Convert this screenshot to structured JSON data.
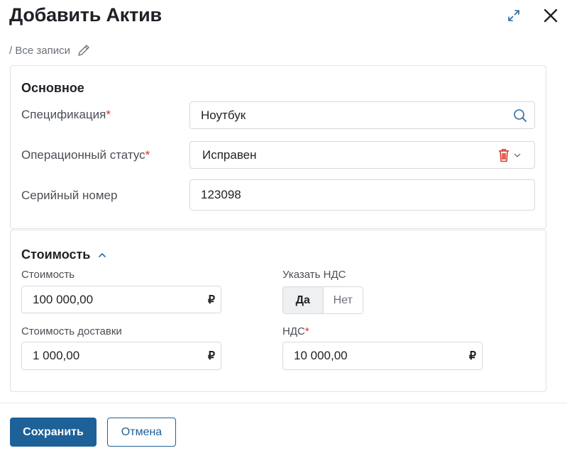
{
  "dialog": {
    "title": "Добавить Актив",
    "breadcrumb": "/ Все записи"
  },
  "main_section": {
    "title": "Основное",
    "rows": [
      {
        "label": "Спецификация",
        "required": "*",
        "value": "Ноутбук",
        "icon": "search-icon"
      },
      {
        "label": "Операционный статус",
        "required": "*",
        "value": "Исправен",
        "icon": "trash-icon"
      },
      {
        "label": "Серийный номер",
        "required": "",
        "value": "123098"
      }
    ]
  },
  "cost_section": {
    "title": "Стоимость",
    "cost": {
      "label": "Стоимость",
      "value": "100 000,00",
      "currency": "₽"
    },
    "delivery": {
      "label": "Стоимость доставки",
      "value": "1 000,00",
      "currency": "₽"
    },
    "vat_toggle": {
      "label": "Указать НДС",
      "yes": "Да",
      "no": "Нет",
      "selected": "Да"
    },
    "vat": {
      "label": "НДС",
      "required": "*",
      "value": "10 000,00",
      "currency": "₽"
    }
  },
  "footer": {
    "save_label": "Сохранить",
    "cancel_label": "Отмена"
  },
  "colors": {
    "primary": "#1d6198",
    "required": "#d93025",
    "icon_blue": "#2b6aa0"
  }
}
